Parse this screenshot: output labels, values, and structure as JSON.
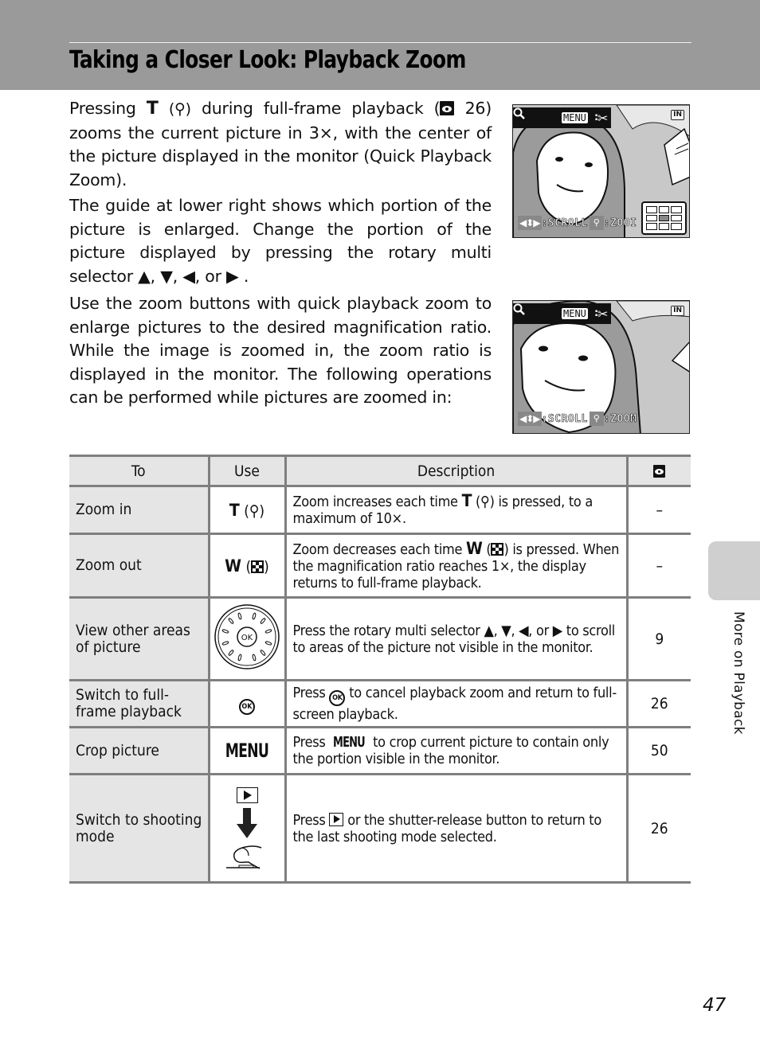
{
  "header": {
    "title": "Taking a Closer Look: Playback Zoom"
  },
  "intro": {
    "p1": {
      "pre": "Pressing ",
      "key": "T",
      "key_glyph": "(⚲)",
      "mid": " during full-frame playback (",
      "ref_page": "26",
      "post": ") zooms the current picture in 3×, with the center of the picture displayed in the monitor (Quick Playback Zoom)."
    },
    "p2": {
      "text": "The guide at lower right shows which portion of the picture is enlarged. Change the portion of the picture displayed by pressing the rotary multi selector ",
      "arrows": "▲, ▼, ◀, or ▶ ."
    },
    "p3": {
      "text": "Use the zoom buttons with quick playback zoom to enlarge pictures to the desired magnification ratio. While the image is zoomed in, the zoom ratio is displayed in the monitor. The following operations can be performed while pictures are zoomed in:"
    }
  },
  "screens": [
    {
      "menu_label": "MENU",
      "memory_label": "IN",
      "scroll_label": ":SCROLL",
      "zoom_label": ":ZOOI",
      "guide_active_cell": 4
    },
    {
      "menu_label": "MENU",
      "memory_label": "IN",
      "scroll_label": ":SCROLL",
      "zoom_label": ":ZOOM"
    }
  ],
  "table": {
    "headers": {
      "to": "To",
      "use": "Use",
      "description": "Description",
      "page_icon": "reference-page-icon"
    },
    "rows": [
      {
        "to": "Zoom in",
        "use_key": "T",
        "use_glyph": "(⚲)",
        "desc_pre": "Zoom increases each time ",
        "desc_key": "T",
        "desc_glyph": "(⚲)",
        "desc_post": " is pressed, to a maximum of 10×.",
        "page": "–"
      },
      {
        "to": "Zoom out",
        "use_key": "W",
        "desc_pre": "Zoom decreases each time ",
        "desc_key": "W",
        "desc_post": " is pressed. When the magnification ratio reaches 1×, the display returns to full-frame playback.",
        "page": "–"
      },
      {
        "to": "View other areas of picture",
        "use_icon": "rotary-multi-selector",
        "use_ok": "OK",
        "desc": "Press the rotary multi selector ▲, ▼, ◀, or ▶  to scroll to areas of the picture not visible in the monitor.",
        "page": "9"
      },
      {
        "to": "Switch to full-frame playback",
        "use_icon": "ok-button",
        "use_ok": "OK",
        "desc_pre": "Press ",
        "desc_post": " to cancel playback zoom and return to full-screen playback.",
        "page": "26"
      },
      {
        "to": "Crop picture",
        "use_label": "MENU",
        "desc_pre": "Press ",
        "desc_key": "MENU",
        "desc_post": " to crop current picture to contain only the portion visible in the monitor.",
        "page": "50"
      },
      {
        "to": "Switch to shooting mode",
        "use_icon": "playback-button-then-shutter",
        "desc_pre": "Press ",
        "desc_post": " or the shutter-release button to return to the last shooting mode selected.",
        "page": "26"
      }
    ]
  },
  "side_tab": {
    "label": "More on Playback"
  },
  "page_number": "47"
}
